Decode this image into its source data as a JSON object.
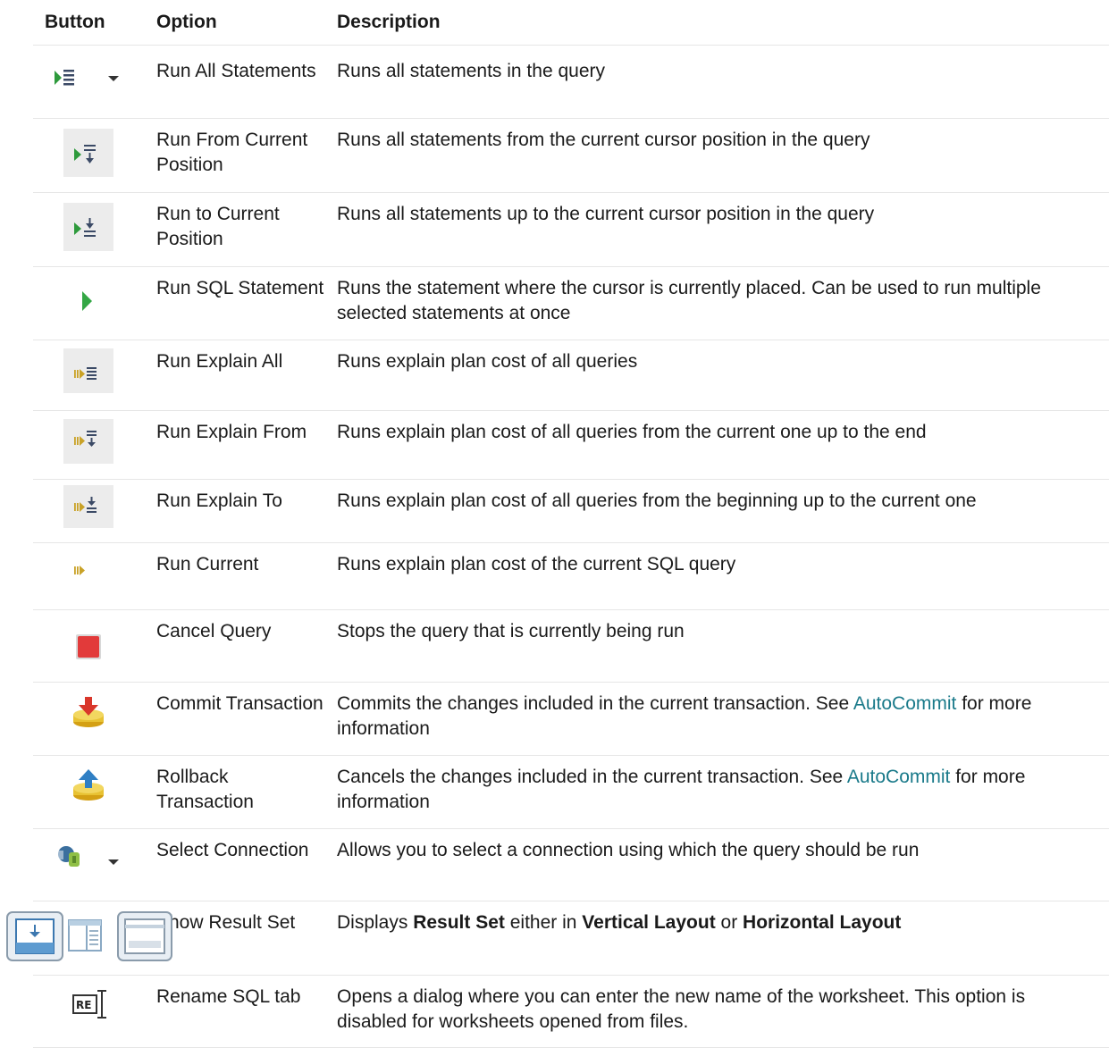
{
  "headers": {
    "button": "Button",
    "option": "Option",
    "description": "Description"
  },
  "link_text": "AutoCommit",
  "rows": [
    {
      "icon": "run-all-icon",
      "option": "Run All Statements",
      "description": "Runs all statements in the query"
    },
    {
      "icon": "run-from-current-icon",
      "option": "Run From Current Position",
      "description": "Runs all statements from the current cursor position in the query"
    },
    {
      "icon": "run-to-current-icon",
      "option": "Run to Current Position",
      "description": "Runs all statements up to the current cursor position in the query"
    },
    {
      "icon": "run-sql-icon",
      "option": "Run SQL Statement",
      "description": "Runs the statement where the cursor is currently placed. Can be used to run multiple selected statements at once"
    },
    {
      "icon": "explain-all-icon",
      "option": "Run Explain All",
      "description": "Runs explain plan cost of all queries"
    },
    {
      "icon": "explain-from-icon",
      "option": "Run Explain From",
      "description": "Runs explain plan cost of all queries from the current one up to the end"
    },
    {
      "icon": "explain-to-icon",
      "option": "Run Explain To",
      "description": "Runs explain plan cost of all queries from the beginning up to the current one"
    },
    {
      "icon": "run-current-explain-icon",
      "option": "Run Current",
      "description": "Runs explain plan cost of the current SQL query"
    },
    {
      "icon": "cancel-query-icon",
      "option": "Cancel Query",
      "description": "Stops the query that is currently being run"
    },
    {
      "icon": "commit-icon",
      "option": "Commit Transaction",
      "description_pre": "Commits the changes included in the current transaction. See ",
      "description_post": " for more information"
    },
    {
      "icon": "rollback-icon",
      "option": "Rollback Transaction",
      "description_pre": "Cancels the changes included in the current transaction. See ",
      "description_post": " for more information"
    },
    {
      "icon": "select-connection-icon",
      "option": "Select Connection",
      "description": "Allows you to select a connection using which the query should be run"
    },
    {
      "icon": "result-set-layout-icons",
      "option": "Show Result Set",
      "description_parts": {
        "p1": "Displays ",
        "b1": "Result Set",
        "p2": " either in ",
        "b2": "Vertical Layout",
        "p3": " or ",
        "b3": "Horizontal Layout"
      }
    },
    {
      "icon": "rename-tab-icon",
      "option": "Rename SQL tab",
      "description": "Opens a dialog where you can enter the new name of the worksheet. This option is disabled for worksheets opened from files."
    }
  ]
}
